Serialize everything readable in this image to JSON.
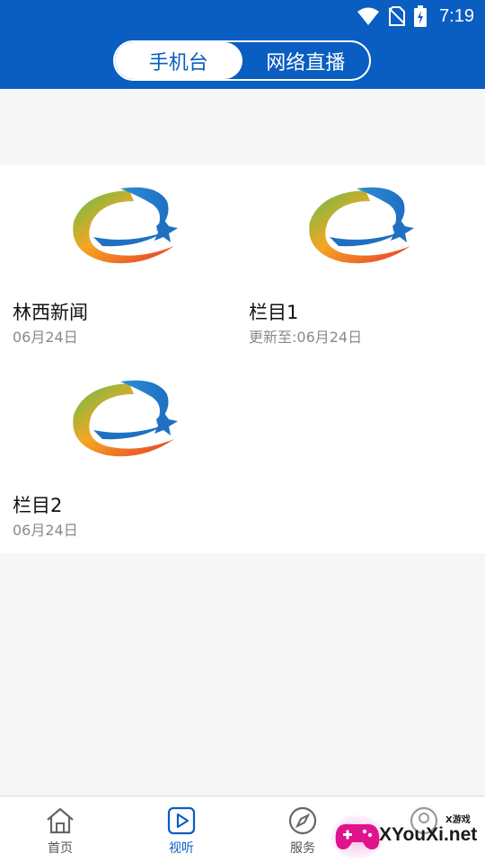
{
  "status_bar": {
    "time": "7:19"
  },
  "header": {
    "tabs": [
      {
        "label": "手机台",
        "active": true
      },
      {
        "label": "网络直播",
        "active": false
      }
    ]
  },
  "programs": [
    {
      "title": "林西新闻",
      "date": "06月24日"
    },
    {
      "title": "栏目1",
      "date": "更新至:06月24日"
    },
    {
      "title": "栏目2",
      "date": "06月24日"
    }
  ],
  "bottom_nav": [
    {
      "label": "首页",
      "icon": "home-icon",
      "active": false
    },
    {
      "label": "视听",
      "icon": "play-icon",
      "active": true
    },
    {
      "label": "服务",
      "icon": "compass-icon",
      "active": false
    },
    {
      "label": "",
      "icon": "profile-icon",
      "active": false
    }
  ],
  "watermark": {
    "text": "XYouXi.net",
    "small": "X游戏"
  },
  "colors": {
    "brand_blue": "#0a5dc1",
    "muted_text": "#8a8a8a"
  }
}
